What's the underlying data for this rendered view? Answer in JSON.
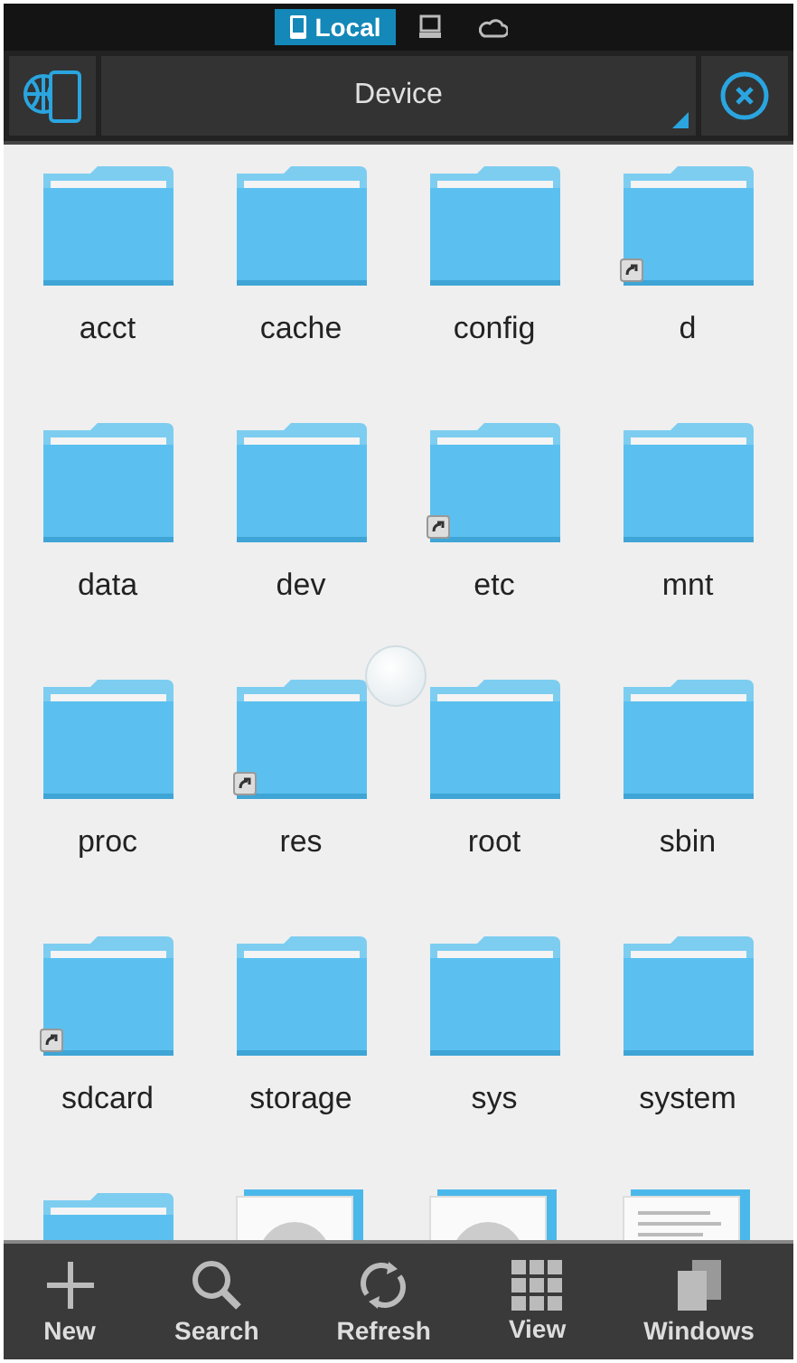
{
  "location_tabs": [
    {
      "kind": "local",
      "label": "Local",
      "selected": true
    },
    {
      "kind": "network",
      "selected": false
    },
    {
      "kind": "cloud",
      "selected": false
    }
  ],
  "toolbar": {
    "path": "Device"
  },
  "items": [
    {
      "kind": "folder",
      "name": "acct",
      "shortcut": false
    },
    {
      "kind": "folder",
      "name": "cache",
      "shortcut": false
    },
    {
      "kind": "folder",
      "name": "config",
      "shortcut": false
    },
    {
      "kind": "folder",
      "name": "d",
      "shortcut": true
    },
    {
      "kind": "folder",
      "name": "data",
      "shortcut": false
    },
    {
      "kind": "folder",
      "name": "dev",
      "shortcut": false
    },
    {
      "kind": "folder",
      "name": "etc",
      "shortcut": true
    },
    {
      "kind": "folder",
      "name": "mnt",
      "shortcut": false
    },
    {
      "kind": "folder",
      "name": "proc",
      "shortcut": false
    },
    {
      "kind": "folder",
      "name": "res",
      "shortcut": true
    },
    {
      "kind": "folder",
      "name": "root",
      "shortcut": false
    },
    {
      "kind": "folder",
      "name": "sbin",
      "shortcut": false
    },
    {
      "kind": "folder",
      "name": "sdcard",
      "shortcut": true
    },
    {
      "kind": "folder",
      "name": "storage",
      "shortcut": false
    },
    {
      "kind": "folder",
      "name": "sys",
      "shortcut": false
    },
    {
      "kind": "folder",
      "name": "system",
      "shortcut": false
    },
    {
      "kind": "folder"
    },
    {
      "kind": "image"
    },
    {
      "kind": "image"
    },
    {
      "kind": "document"
    }
  ],
  "bottom_bar": [
    {
      "kind": "new",
      "label": "New"
    },
    {
      "kind": "search",
      "label": "Search"
    },
    {
      "kind": "refresh",
      "label": "Refresh"
    },
    {
      "kind": "view",
      "label": "View"
    },
    {
      "kind": "windows",
      "label": "Windows"
    }
  ]
}
